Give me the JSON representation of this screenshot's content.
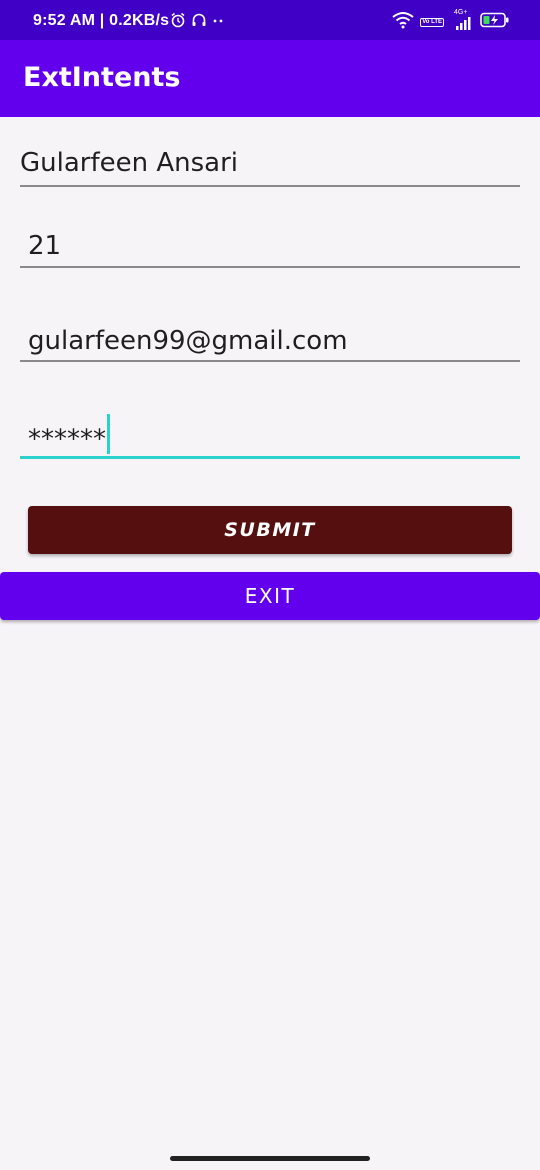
{
  "status_bar": {
    "time_and_speed": "9:52 AM | 0.2KB/s",
    "lte_label": "Vo LTE",
    "network_label": "4G+",
    "icons": [
      "alarm-icon",
      "headset-icon",
      "more-dots-icon",
      "wifi-icon",
      "volte-icon",
      "signal-icon",
      "battery-charging-icon"
    ]
  },
  "app_bar": {
    "title": "ExtIntents"
  },
  "form": {
    "name_value": "Gularfeen Ansari",
    "age_value": "21",
    "email_value": "gularfeen99@gmail.com",
    "password_value": "******"
  },
  "buttons": {
    "submit_label": "SUBMIT",
    "exit_label": "EXIT"
  },
  "colors": {
    "status_bar": "#4100c6",
    "app_bar": "#6200ee",
    "submit_button": "#550f0f",
    "exit_button": "#6200ee",
    "focus_accent": "#2ad2c9",
    "background": "#f7f4f8"
  }
}
